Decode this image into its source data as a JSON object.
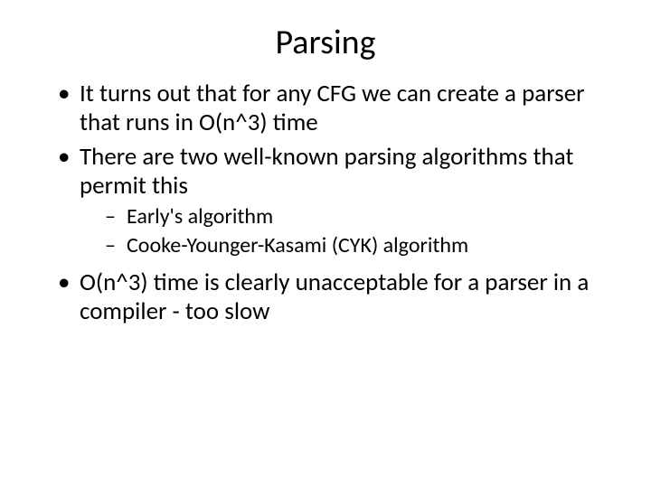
{
  "title": "Parsing",
  "bullets": {
    "b1": "It turns out that for any CFG we can create a parser that runs in O(n^3) time",
    "b2": "There are two well-known parsing algorithms that permit this",
    "b2_sub": {
      "s1": "Early's algorithm",
      "s2": "Cooke-Younger-Kasami (CYK) algorithm"
    },
    "b3": "O(n^3) time is clearly unacceptable for a parser in a compiler - too slow"
  }
}
